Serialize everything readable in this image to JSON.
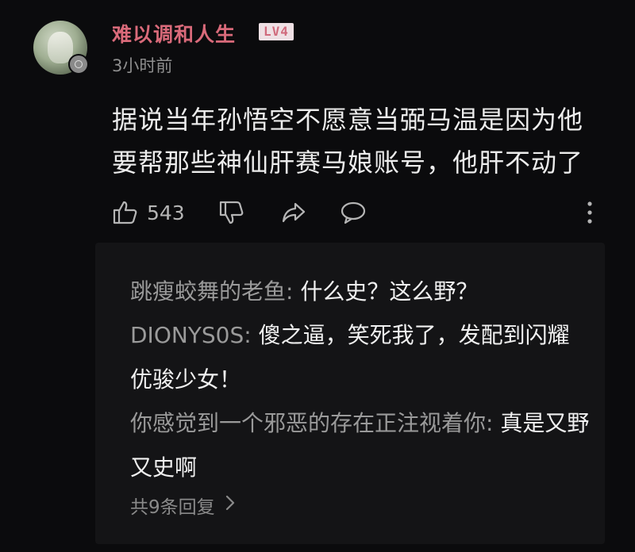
{
  "comment": {
    "username": "难以调和人生",
    "level_badge": "LV4",
    "time": "3小时前",
    "text": "据说当年孙悟空不愿意当弼马温是因为他要帮那些神仙肝赛马娘账号，他肝不动了",
    "like_count": "543"
  },
  "replies": [
    {
      "author": "跳瘦蛟舞的老鱼",
      "text": "什么史？这么野？"
    },
    {
      "author": "DIONYS0S",
      "text": "傻之逼，笑死我了，发配到闪耀优骏少女！"
    },
    {
      "author": "你感觉到一个邪恶的存在正注视着你",
      "text": "真是又野又史啊"
    }
  ],
  "more_replies_label": "共9条回复",
  "colors": {
    "background": "#0b0b0d",
    "username": "#d96a7a",
    "reply_box": "#141416",
    "muted": "#9a9a9a"
  },
  "icons": [
    "thumbs-up-icon",
    "thumbs-down-icon",
    "share-icon",
    "comment-bubble-icon",
    "more-vertical-icon",
    "chevron-right-icon"
  ]
}
